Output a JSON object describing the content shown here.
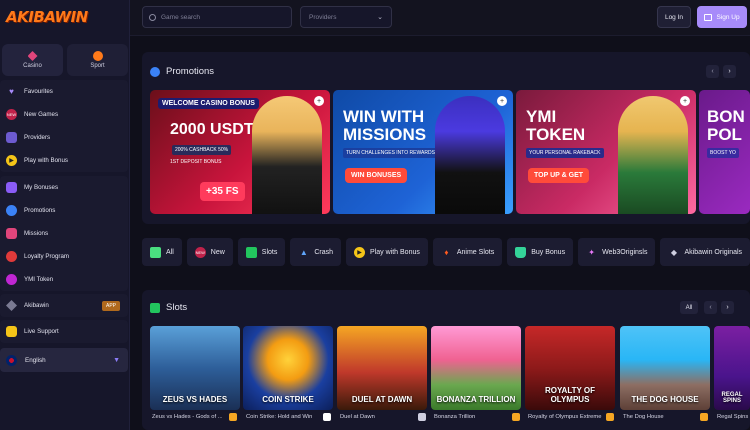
{
  "brand": {
    "logo": "AKIBAWIN",
    "accent": "#a78bfa",
    "orange": "#ff7a1a"
  },
  "sidebar": {
    "tabs": [
      {
        "label": "Casino",
        "icon": "casino-icon"
      },
      {
        "label": "Sport",
        "icon": "basketball-icon"
      }
    ],
    "group1": [
      {
        "label": "Favourites",
        "icon": "heart-icon"
      },
      {
        "label": "New Games",
        "icon": "new-badge-icon"
      },
      {
        "label": "Providers",
        "icon": "providers-icon"
      },
      {
        "label": "Play with Bonus",
        "icon": "play-icon"
      }
    ],
    "group2": [
      {
        "label": "My Bonuses",
        "icon": "bonus-icon"
      },
      {
        "label": "Promotions",
        "icon": "promotion-icon"
      },
      {
        "label": "Missions",
        "icon": "missions-icon"
      },
      {
        "label": "Loyalty Program",
        "icon": "loyalty-icon"
      },
      {
        "label": "YMI Token",
        "icon": "token-icon"
      }
    ],
    "group3": [
      {
        "label": "Akibawin",
        "icon": "akibawin-icon",
        "badge": "APP"
      }
    ],
    "group4": [
      {
        "label": "Live Support",
        "icon": "chat-icon"
      }
    ],
    "language": {
      "label": "English",
      "icon": "uk-flag-icon"
    }
  },
  "topbar": {
    "search_placeholder": "Game search",
    "providers_label": "Providers",
    "login_label": "Log In",
    "signup_label": "Sign Up"
  },
  "promotions": {
    "title": "Promotions",
    "cards": [
      {
        "line1": "WELCOME CASINO BONUS",
        "line2": "2000 USDT",
        "line3": "200%   CASHBACK 50%",
        "line4": "1ST DEPOSIT BONUS",
        "cta": "+35 FS"
      },
      {
        "line1": "WIN WITH",
        "line2": "MISSIONS",
        "line3": "TURN CHALLENGES INTO REWARDS",
        "cta": "WIN BONUSES"
      },
      {
        "line1": "YMI",
        "line2": "TOKEN",
        "line3": "YOUR PERSONAL RAKEBACK",
        "cta": "TOP UP & GET"
      },
      {
        "line1": "BON",
        "line2": "POL",
        "line3": "BOOST YO"
      }
    ]
  },
  "chips": [
    {
      "label": "All",
      "icon": "grid-icon"
    },
    {
      "label": "New",
      "icon": "new-badge-icon"
    },
    {
      "label": "Slots",
      "icon": "slots-icon"
    },
    {
      "label": "Crash",
      "icon": "rocket-icon"
    },
    {
      "label": "Play with Bonus",
      "icon": "play-icon"
    },
    {
      "label": "Anime Slots",
      "icon": "flame-icon"
    },
    {
      "label": "Buy Bonus",
      "icon": "bag-icon"
    },
    {
      "label": "Web3Originsls",
      "icon": "web3-icon"
    },
    {
      "label": "Akibawin Originals",
      "icon": "akibawin-icon"
    }
  ],
  "slots": {
    "title": "Slots",
    "all_label": "All",
    "games": [
      {
        "name": "Zeus vs Hades - Gods of ...",
        "art": "ZEUS VS HADES",
        "provider_icon": "pragmatic-icon"
      },
      {
        "name": "Coin Strike: Hold and Win",
        "art": "COIN STRIKE",
        "provider_icon": "playson-icon"
      },
      {
        "name": "Duel at Dawn",
        "art": "DUEL AT DAWN",
        "provider_icon": "hacksaw-icon"
      },
      {
        "name": "Bonanza Trillion",
        "art": "BONANZA TRILLION",
        "provider_icon": "pragmatic-icon"
      },
      {
        "name": "Royalty of Olympus Extreme",
        "art": "ROYALTY OF OLYMPUS",
        "provider_icon": "pragmatic-icon"
      },
      {
        "name": "The Dog House",
        "art": "THE DOG HOUSE",
        "provider_icon": "pragmatic-icon"
      },
      {
        "name": "Regal Spins",
        "art": "REGAL SPINS",
        "provider_icon": "pragmatic-icon"
      }
    ]
  }
}
